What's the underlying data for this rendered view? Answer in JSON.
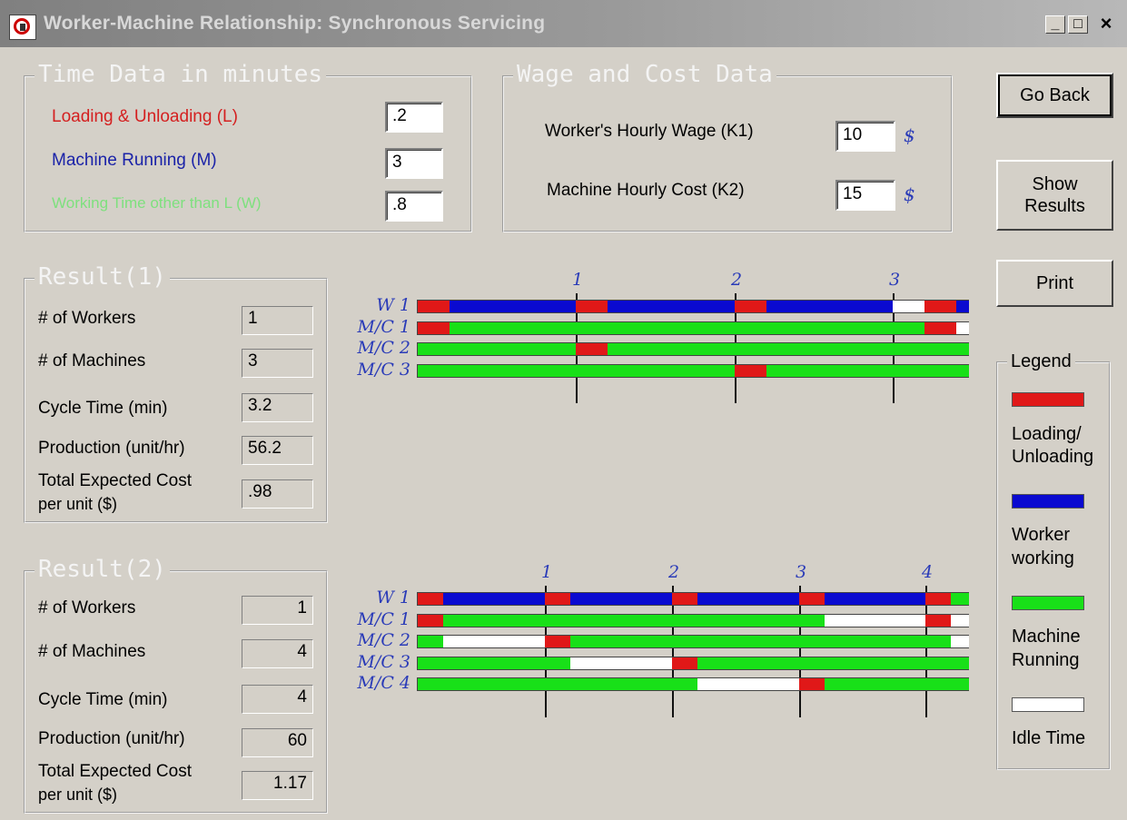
{
  "window": {
    "title": "Worker-Machine Relationship: Synchronous Servicing",
    "minimize": "_",
    "maximize": "□",
    "close": "×"
  },
  "time_data": {
    "title": "Time Data in minutes",
    "loading_label": "Loading & Unloading (L)",
    "loading_value": ".2",
    "running_label": "Machine Running (M)",
    "running_value": "3",
    "working_label": "Working Time other than L (W)",
    "working_value": ".8",
    "colors": {
      "loading": "#d42020",
      "running": "#1a22a8",
      "working": "#7ee07e"
    }
  },
  "wage_data": {
    "title": "Wage and Cost Data",
    "wage_label": "Worker's Hourly Wage (K1)",
    "wage_value": "10",
    "cost_label": "Machine Hourly Cost (K2)",
    "cost_value": "15",
    "currency": "$"
  },
  "buttons": {
    "go_back": "Go Back",
    "show_results_line1": "Show",
    "show_results_line2": "Results",
    "print": "Print"
  },
  "result1": {
    "title": "Result(1)",
    "workers_label": "# of Workers",
    "workers_value": "1",
    "machines_label": "# of Machines",
    "machines_value": "3",
    "cycle_label": "Cycle Time (min)",
    "cycle_value": "3.2",
    "production_label": "Production (unit/hr)",
    "production_value": "56.2",
    "cost_label_line1": "Total Expected Cost",
    "cost_label_line2": "per unit ($)",
    "cost_value": ".98"
  },
  "result2": {
    "title": "Result(2)",
    "workers_label": "# of Workers",
    "workers_value": "1",
    "machines_label": "# of Machines",
    "machines_value": "4",
    "cycle_label": "Cycle Time (min)",
    "cycle_value": "4",
    "production_label": "Production (unit/hr)",
    "production_value": "60",
    "cost_label_line1": "Total Expected Cost",
    "cost_label_line2": "per unit ($)",
    "cost_value": "1.17"
  },
  "legend": {
    "title": "Legend",
    "loading_line1": "Loading/",
    "loading_line2": "Unloading",
    "worker_line1": "Worker",
    "worker_line2": "working",
    "running_line1": "Machine",
    "running_line2": "Running",
    "idle": "Idle Time",
    "colors": {
      "loading": "#e01818",
      "worker": "#0a0ad0",
      "running": "#18e018",
      "idle": "#ffffff"
    }
  },
  "gantt1": {
    "rows": [
      "W 1",
      "M/C 1",
      "M/C 2",
      "M/C 3"
    ],
    "ticks": [
      "1",
      "2",
      "3"
    ],
    "segments": [
      [
        [
          "L",
          0,
          0.2
        ],
        [
          "W",
          0.2,
          1
        ],
        [
          "L",
          1,
          1.2
        ],
        [
          "W",
          1.2,
          2
        ],
        [
          "L",
          2,
          2.2
        ],
        [
          "W",
          2.2,
          3
        ],
        [
          "I",
          3,
          3.2
        ],
        [
          "L",
          3.2,
          3.4
        ],
        [
          "W",
          3.4,
          3.48
        ]
      ],
      [
        [
          "L",
          0,
          0.2
        ],
        [
          "R",
          0.2,
          3.2
        ],
        [
          "L",
          3.2,
          3.4
        ],
        [
          "I",
          3.4,
          3.48
        ]
      ],
      [
        [
          "R",
          0,
          1
        ],
        [
          "L",
          1,
          1.2
        ],
        [
          "R",
          1.2,
          3.48
        ]
      ],
      [
        [
          "R",
          0,
          2
        ],
        [
          "L",
          2,
          2.2
        ],
        [
          "R",
          2.2,
          3.48
        ]
      ]
    ],
    "max": 3.48
  },
  "gantt2": {
    "rows": [
      "W 1",
      "M/C 1",
      "M/C 2",
      "M/C 3",
      "M/C 4"
    ],
    "ticks": [
      "1",
      "2",
      "3",
      "4"
    ],
    "segments": [
      [
        [
          "L",
          0,
          0.2
        ],
        [
          "W",
          0.2,
          1
        ],
        [
          "L",
          1,
          1.2
        ],
        [
          "W",
          1.2,
          2
        ],
        [
          "L",
          2,
          2.2
        ],
        [
          "W",
          2.2,
          3
        ],
        [
          "L",
          3,
          3.2
        ],
        [
          "W",
          3.2,
          4
        ],
        [
          "L",
          4,
          4.2
        ],
        [
          "R",
          4.2,
          4.34
        ]
      ],
      [
        [
          "L",
          0,
          0.2
        ],
        [
          "R",
          0.2,
          3.2
        ],
        [
          "I",
          3.2,
          4
        ],
        [
          "L",
          4,
          4.2
        ],
        [
          "I",
          4.2,
          4.34
        ]
      ],
      [
        [
          "R",
          0,
          0.2
        ],
        [
          "I",
          0.2,
          1
        ],
        [
          "L",
          1,
          1.2
        ],
        [
          "R",
          1.2,
          4.2
        ],
        [
          "I",
          4.2,
          4.34
        ]
      ],
      [
        [
          "R",
          0,
          1.2
        ],
        [
          "I",
          1.2,
          2
        ],
        [
          "L",
          2,
          2.2
        ],
        [
          "R",
          2.2,
          4.34
        ]
      ],
      [
        [
          "R",
          0,
          2.2
        ],
        [
          "I",
          2.2,
          3
        ],
        [
          "L",
          3,
          3.2
        ],
        [
          "R",
          3.2,
          4.34
        ]
      ]
    ],
    "max": 4.34
  }
}
